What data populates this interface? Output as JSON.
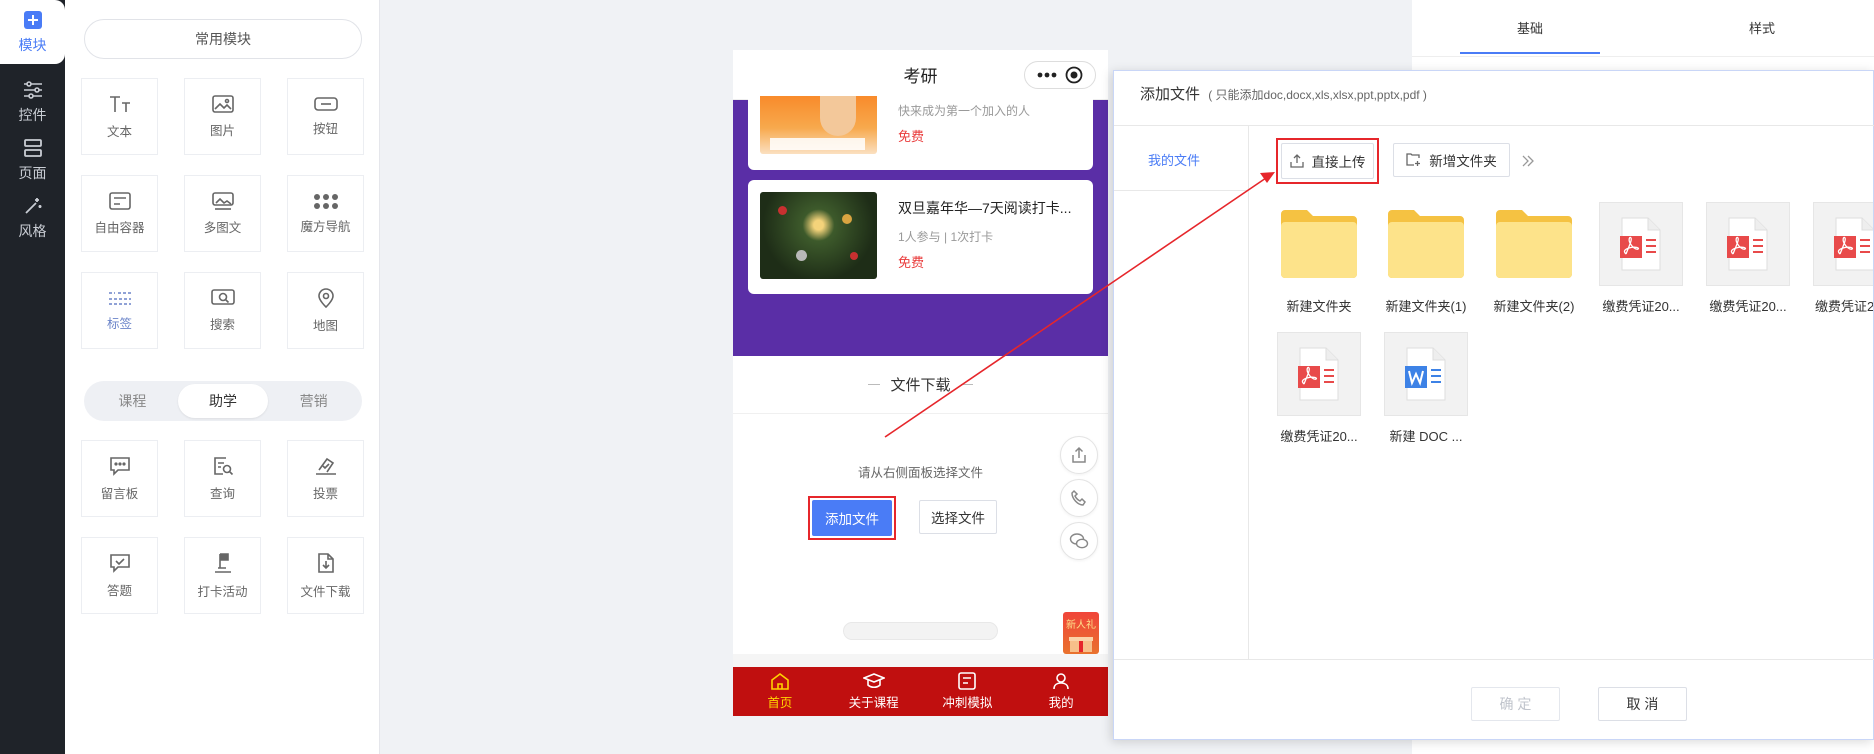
{
  "nav": {
    "items": [
      {
        "label": "模块",
        "icon": "plus-square-icon",
        "active": true
      },
      {
        "label": "控件",
        "icon": "sliders-icon",
        "active": false
      },
      {
        "label": "页面",
        "icon": "page-layout-icon",
        "active": false
      },
      {
        "label": "风格",
        "icon": "magic-wand-icon",
        "active": false
      }
    ]
  },
  "modules": {
    "common_title": "常用模块",
    "common": [
      {
        "label": "文本",
        "icon": "text-icon"
      },
      {
        "label": "图片",
        "icon": "image-icon"
      },
      {
        "label": "按钮",
        "icon": "button-icon"
      },
      {
        "label": "自由容器",
        "icon": "container-icon"
      },
      {
        "label": "多图文",
        "icon": "multi-image-icon"
      },
      {
        "label": "魔方导航",
        "icon": "grid-dots-icon"
      },
      {
        "label": "标签",
        "icon": "tag-lines-icon"
      },
      {
        "label": "搜索",
        "icon": "search-icon"
      },
      {
        "label": "地图",
        "icon": "map-pin-icon"
      }
    ],
    "tabs": [
      {
        "label": "课程",
        "active": false
      },
      {
        "label": "助学",
        "active": true
      },
      {
        "label": "营销",
        "active": false
      }
    ],
    "study": [
      {
        "label": "留言板",
        "icon": "message-board-icon"
      },
      {
        "label": "查询",
        "icon": "query-icon"
      },
      {
        "label": "投票",
        "icon": "vote-icon"
      },
      {
        "label": "答题",
        "icon": "quiz-icon"
      },
      {
        "label": "打卡活动",
        "icon": "checkin-flag-icon"
      },
      {
        "label": "文件下载",
        "icon": "file-download-icon"
      }
    ]
  },
  "phone": {
    "title": "考研",
    "cards": [
      {
        "sub": "快来成为第一个加入的人",
        "price": "免费"
      },
      {
        "title": "双旦嘉年华—7天阅读打卡...",
        "sub": "1人参与 | 1次打卡",
        "price": "免费"
      }
    ],
    "file_section_title": "文件下载",
    "hint": "请从右侧面板选择文件",
    "add_file_label": "添加文件",
    "choose_file_label": "选择文件",
    "gift_label": "新人礼",
    "tabbar": [
      {
        "label": "首页",
        "icon": "home-icon",
        "active": true
      },
      {
        "label": "关于课程",
        "icon": "graduation-cap-icon",
        "active": false
      },
      {
        "label": "冲刺模拟",
        "icon": "exam-icon",
        "active": false
      },
      {
        "label": "我的",
        "icon": "user-icon",
        "active": false
      }
    ]
  },
  "right_panel": {
    "tabs": [
      {
        "label": "基础",
        "active": true
      },
      {
        "label": "样式",
        "active": false
      }
    ]
  },
  "dialog": {
    "title": "添加文件",
    "subtitle": "( 只能添加doc,docx,xls,xlsx,ppt,pptx,pdf )",
    "sidebar_item": "我的文件",
    "upload_label": "直接上传",
    "new_folder_label": "新增文件夹",
    "files": [
      {
        "name": "新建文件夹",
        "type": "folder"
      },
      {
        "name": "新建文件夹(1)",
        "type": "folder"
      },
      {
        "name": "新建文件夹(2)",
        "type": "folder"
      },
      {
        "name": "缴费凭证20...",
        "type": "pdf"
      },
      {
        "name": "缴费凭证20...",
        "type": "pdf"
      },
      {
        "name": "缴费凭证2",
        "type": "pdf"
      },
      {
        "name": "缴费凭证20...",
        "type": "pdf"
      },
      {
        "name": "新建 DOC ...",
        "type": "doc"
      }
    ],
    "confirm_label": "确 定",
    "cancel_label": "取 消"
  },
  "colors": {
    "accent": "#4a7cf6",
    "nav_bg": "#1f2329",
    "purple": "#5a2ea6",
    "tabbar_red": "#c00f0f",
    "highlight_red": "#e6262b",
    "folder": "#fde38a"
  }
}
